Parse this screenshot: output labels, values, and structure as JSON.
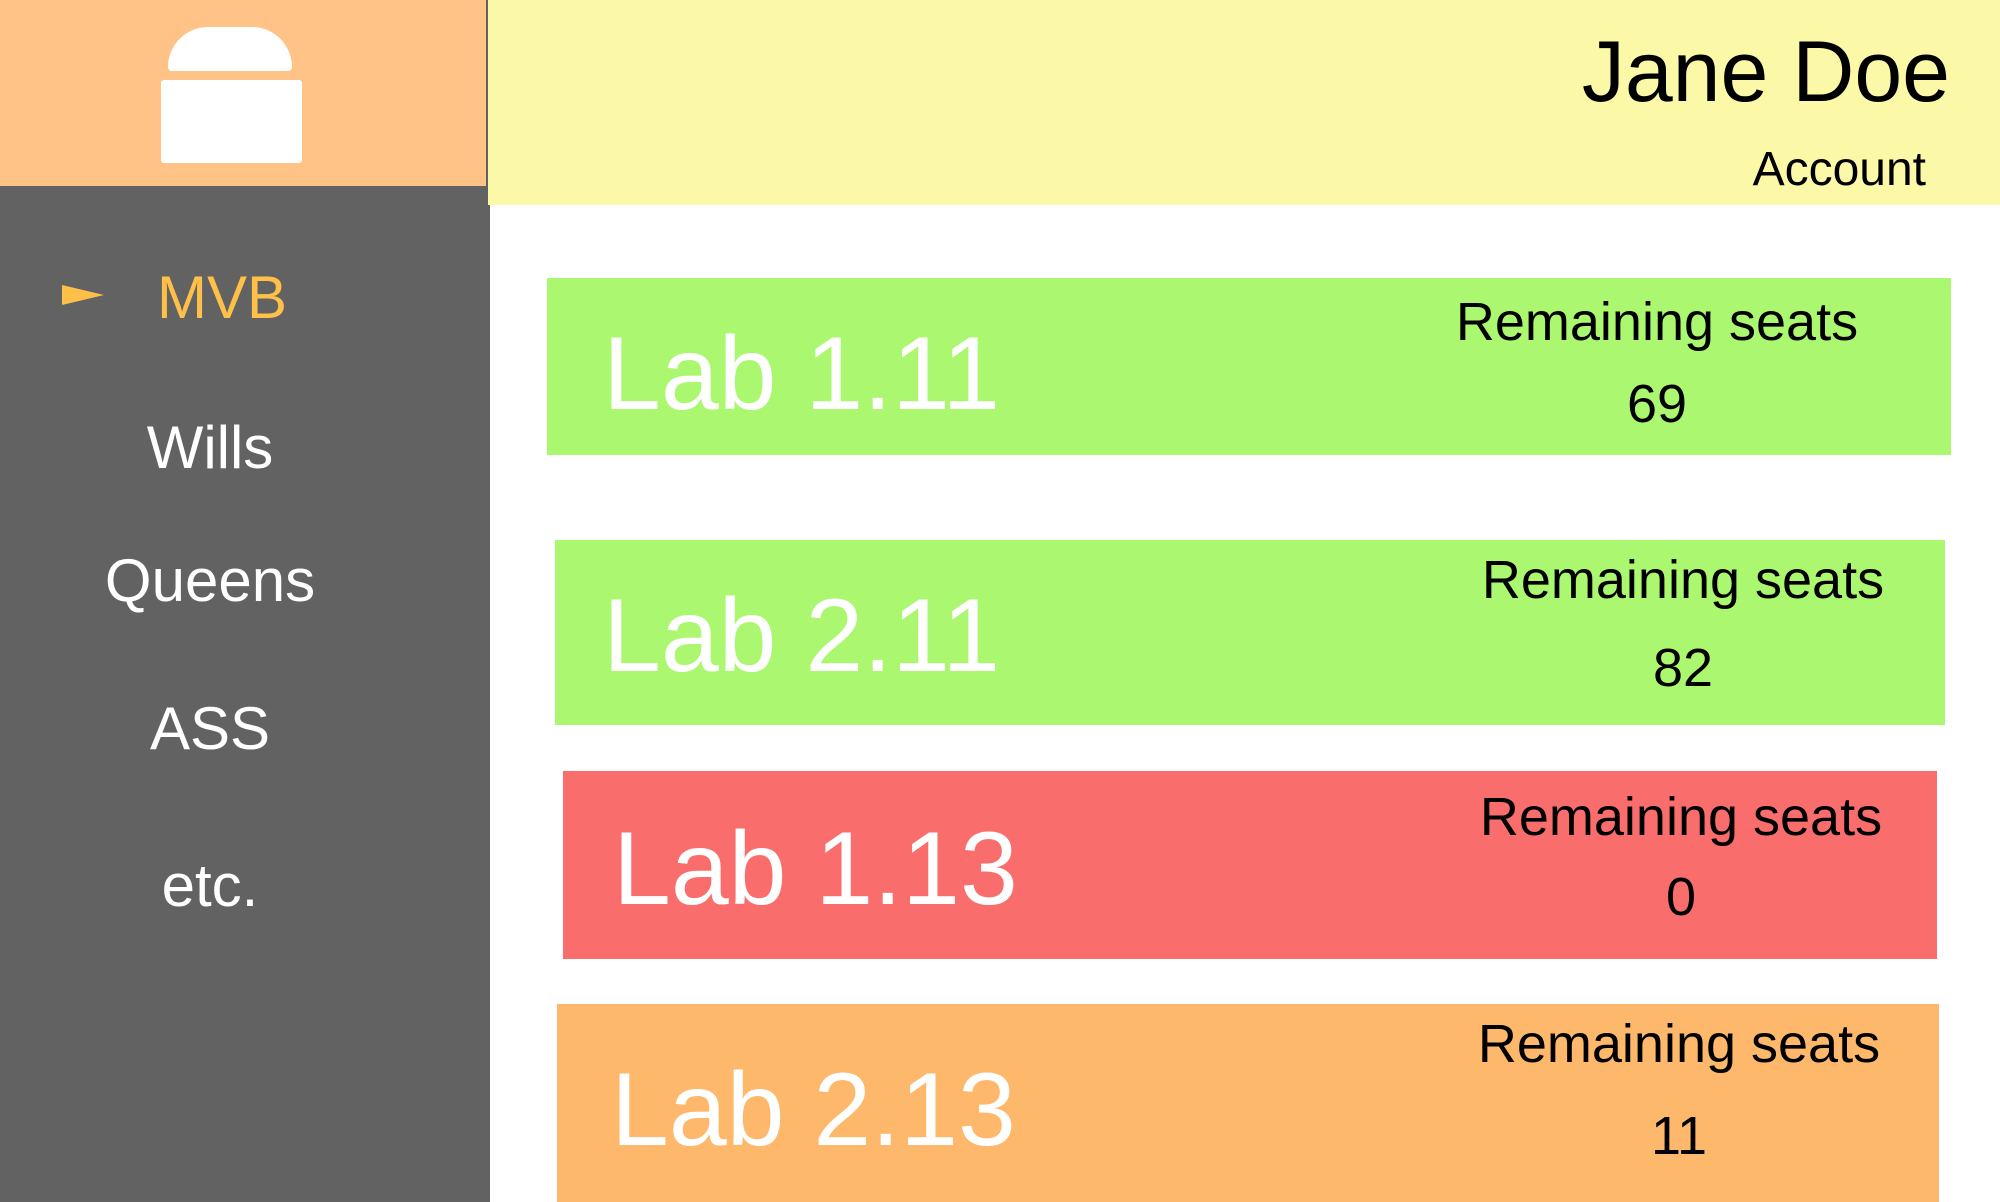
{
  "user": {
    "name": "Jane Doe",
    "account_label": "Account"
  },
  "sidebar": {
    "items": [
      {
        "label": "MVB",
        "active": true
      },
      {
        "label": "Wills",
        "active": false
      },
      {
        "label": "Queens",
        "active": false
      },
      {
        "label": "ASS",
        "active": false
      },
      {
        "label": "etc.",
        "active": false
      }
    ]
  },
  "labs": [
    {
      "name": "Lab 1.11",
      "seats_label": "Remaining seats",
      "seats": "69",
      "status_color": "#abf870"
    },
    {
      "name": "Lab 2.11",
      "seats_label": "Remaining seats",
      "seats": "82",
      "status_color": "#abf870"
    },
    {
      "name": "Lab 1.13",
      "seats_label": "Remaining seats",
      "seats": "0",
      "status_color": "#f96e6d"
    },
    {
      "name": "Lab 2.13",
      "seats_label": "Remaining seats",
      "seats": "11",
      "status_color": "#feb86b"
    }
  ],
  "colors": {
    "sidebar_bg": "#626262",
    "logo_bg": "#ffc387",
    "header_bg": "#fbf9a8",
    "active_nav": "#ffc04a"
  },
  "icons": {
    "logo": "building-logo-icon",
    "active_marker": "pointer-arrow-icon"
  }
}
